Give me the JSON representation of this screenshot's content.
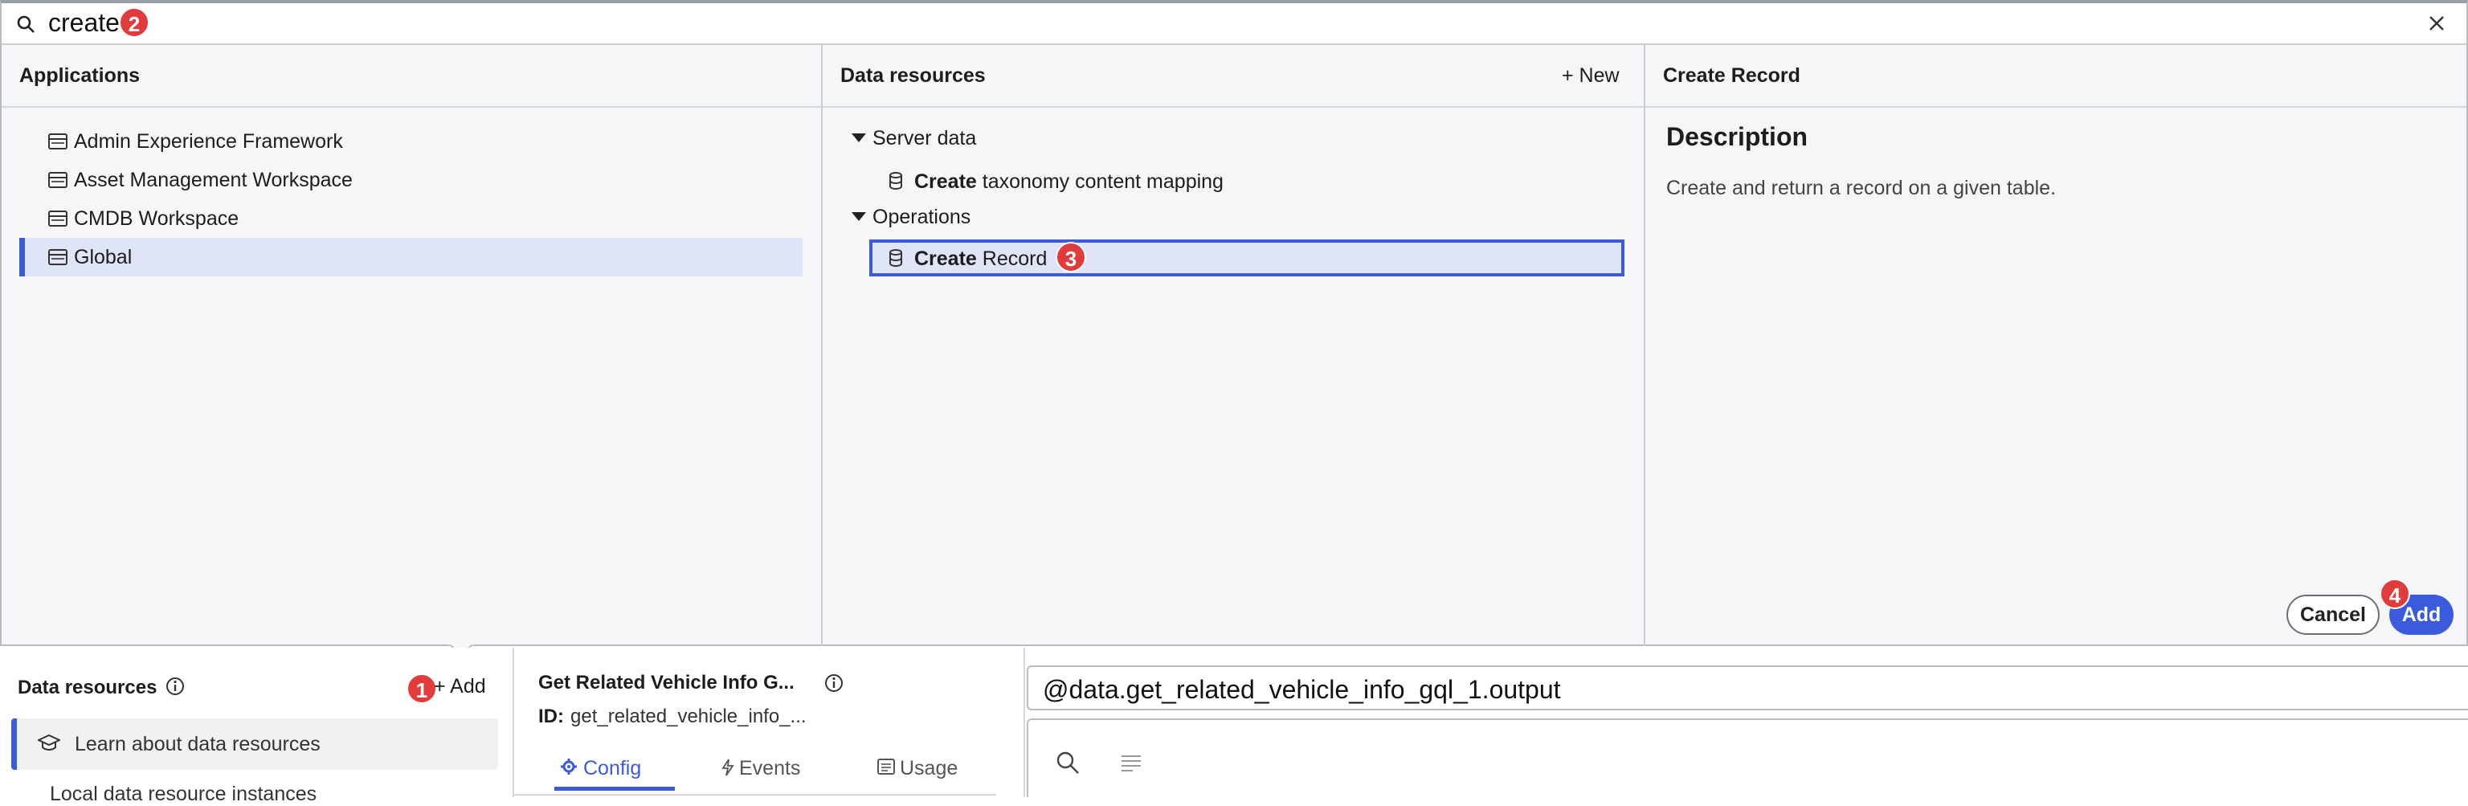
{
  "search": {
    "value": "create"
  },
  "steps": {
    "one": "1",
    "two": "2",
    "three": "3",
    "four": "4"
  },
  "applications": {
    "header": "Applications",
    "items": [
      {
        "label": "Admin Experience Framework"
      },
      {
        "label": "Asset Management Workspace"
      },
      {
        "label": "CMDB Workspace"
      },
      {
        "label": "Global",
        "selected": true
      }
    ]
  },
  "data_resources_col": {
    "header": "Data resources",
    "new_label": "+ New",
    "groups": [
      {
        "label": "Server data",
        "items": [
          {
            "bold": "Create",
            "rest": " taxonomy content mapping"
          }
        ]
      },
      {
        "label": "Operations",
        "items": [
          {
            "bold": "Create",
            "rest": " Record",
            "selected": true
          }
        ]
      }
    ]
  },
  "detail": {
    "header": "Create Record",
    "description_heading": "Description",
    "description_text": "Create and return a record on a given table.",
    "cancel_label": "Cancel",
    "add_label": "Add"
  },
  "bottom": {
    "data_resources_title": "Data resources",
    "add_label": "+ Add",
    "learn_label": "Learn about data resources",
    "local_label": "Local data resource instances",
    "resource_title": "Get Related Vehicle Info G...",
    "id_label": "ID:",
    "id_value": "get_related_vehicle_info_...",
    "tabs": [
      {
        "label": "Config",
        "active": true
      },
      {
        "label": "Events"
      },
      {
        "label": "Usage"
      }
    ],
    "expression": "@data.get_related_vehicle_info_gql_1.output"
  },
  "colors": {
    "accent": "#3d5bd9",
    "badge": "#e23b3b",
    "selected_row": "#dfe4f7"
  },
  "icons": [
    "search-icon",
    "close-icon",
    "application-icon",
    "database-icon",
    "info-icon",
    "graduation-cap-icon",
    "gear-icon",
    "lightning-icon",
    "list-icon",
    "menu-lines-icon"
  ]
}
